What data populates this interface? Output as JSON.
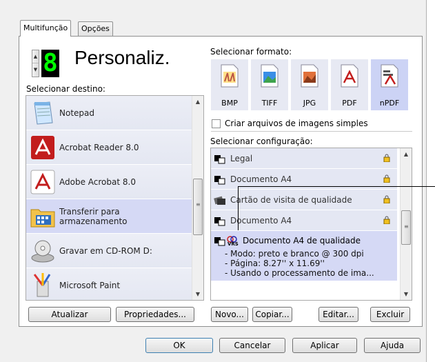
{
  "tabs": [
    {
      "label": "Multifunção",
      "active": true
    },
    {
      "label": "Opções",
      "active": false
    }
  ],
  "profile": {
    "number": "8",
    "name": "Personaliz."
  },
  "destination": {
    "label": "Selecionar destino:",
    "items": [
      {
        "label": "Notepad",
        "icon": "notepad-icon"
      },
      {
        "label": "Acrobat Reader 8.0",
        "icon": "acrobat-icon"
      },
      {
        "label": "Adobe Acrobat 8.0",
        "icon": "acrobat-icon"
      },
      {
        "label": "Transferir para",
        "label2": "armazenamento",
        "icon": "folder-icon",
        "selected": true
      },
      {
        "label": "Gravar em CD-ROM  D:",
        "icon": "cd-drive-icon"
      },
      {
        "label": "Microsoft Paint",
        "icon": "paint-icon"
      }
    ]
  },
  "format": {
    "label": "Selecionar formato:",
    "items": [
      {
        "label": "BMP",
        "icon": "bmp-icon"
      },
      {
        "label": "TIFF",
        "icon": "tiff-icon"
      },
      {
        "label": "JPG",
        "icon": "jpg-icon"
      },
      {
        "label": "PDF",
        "icon": "pdf-icon"
      },
      {
        "label": "nPDF",
        "icon": "npdf-icon",
        "selected": true
      }
    ]
  },
  "simple_images": {
    "label": "Criar arquivos de imagens simples",
    "checked": false
  },
  "configuration": {
    "label": "Selecionar configuração:",
    "items": [
      {
        "label": "Legal"
      },
      {
        "label": "Documento A4"
      },
      {
        "label": "Cartão de visita de qualidade"
      },
      {
        "label": "Documento A4"
      }
    ],
    "selected": {
      "title": "Documento A4 de qualidade",
      "lines": [
        "- Modo: preto e branco @ 300 dpi",
        "- Página:  8.27'' x 11.69''",
        "- Usando o processamento de ima..."
      ]
    }
  },
  "buttons": {
    "atualizar": "Atualizar",
    "propriedades": "Propriedades...",
    "novo": "Novo...",
    "copiar": "Copiar...",
    "editar": "Editar...",
    "excluir": "Excluir",
    "ok": "OK",
    "cancelar": "Cancelar",
    "aplicar": "Aplicar",
    "ajuda": "Ajuda"
  },
  "colors": {
    "digit": "#00ff00",
    "selected_item": "#d5d9f5",
    "list_item": "#e4e7f3"
  }
}
